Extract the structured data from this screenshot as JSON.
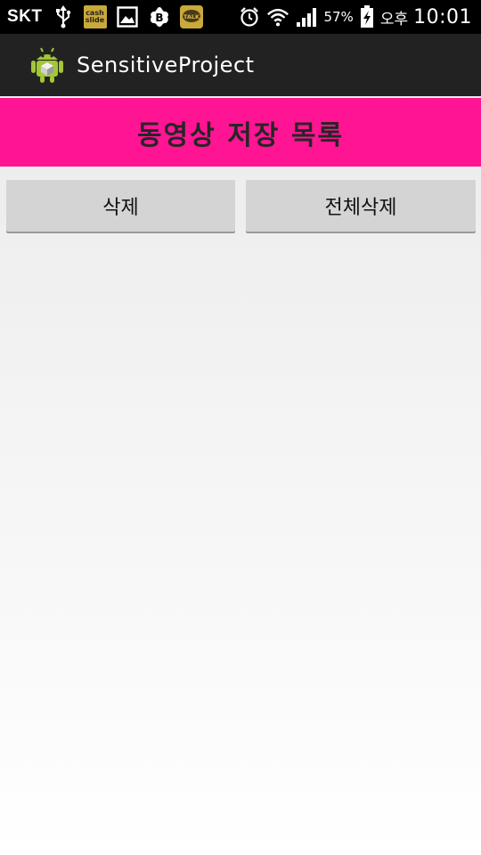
{
  "status_bar": {
    "carrier": "SKT",
    "icons": [
      "usb-icon",
      "cashslide-icon",
      "image-icon",
      "band-icon",
      "kakaotalk-icon",
      "alarm-icon",
      "wifi-icon",
      "signal-icon",
      "battery-charging-icon"
    ],
    "cashslide_label_1": "cash",
    "cashslide_label_2": "slide",
    "kakaotalk_label": "TALK",
    "band_label": "B",
    "battery_percent": "57%",
    "ampm": "오후",
    "time": "10:01"
  },
  "action_bar": {
    "app_icon": "android-icon",
    "title": "SensitiveProject"
  },
  "header": {
    "title": "동영상 저장 목록",
    "color": "#ff1493"
  },
  "buttons": {
    "delete_label": "삭제",
    "delete_all_label": "전체삭제"
  }
}
